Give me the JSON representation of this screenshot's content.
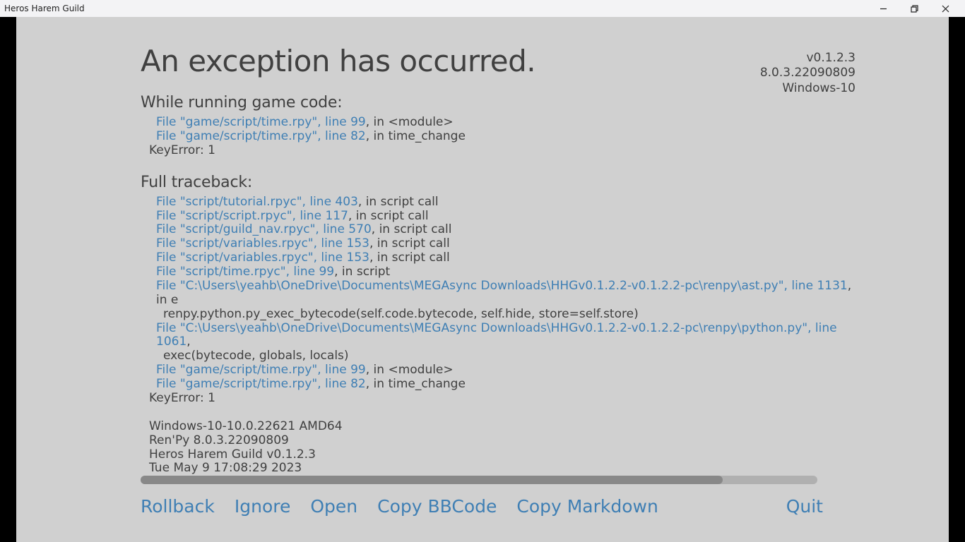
{
  "window": {
    "title": "Heros Harem Guild"
  },
  "versions": {
    "game_version": "v0.1.2.3",
    "renpy_version": "8.0.3.22090809",
    "os": "Windows-10"
  },
  "heading": "An exception has occurred.",
  "section1": {
    "title": "While running game code:",
    "lines": [
      {
        "link": "File \"game/script/time.rpy\", line 99",
        "rest": ", in <module>"
      },
      {
        "link": "File \"game/script/time.rpy\", line 82",
        "rest": ", in time_change"
      }
    ],
    "error": "KeyError: 1"
  },
  "section2": {
    "title": "Full traceback:",
    "lines": [
      {
        "link": "File \"script/tutorial.rpyc\", line 403",
        "rest": ", in script call"
      },
      {
        "link": "File \"script/script.rpyc\", line 117",
        "rest": ", in script call"
      },
      {
        "link": "File \"script/guild_nav.rpyc\", line 570",
        "rest": ", in script call"
      },
      {
        "link": "File \"script/variables.rpyc\", line 153",
        "rest": ", in script call"
      },
      {
        "link": "File \"script/variables.rpyc\", line 153",
        "rest": ", in script call"
      },
      {
        "link": "File \"script/time.rpyc\", line 99",
        "rest": ", in script"
      },
      {
        "link": "File \"C:\\Users\\yeahb\\OneDrive\\Documents\\MEGAsync Downloads\\HHGv0.1.2.2-v0.1.2.2-pc\\renpy\\ast.py\", line 1131",
        "rest": ", in e",
        "sub": "renpy.python.py_exec_bytecode(self.code.bytecode, self.hide, store=self.store)"
      },
      {
        "link": "File \"C:\\Users\\yeahb\\OneDrive\\Documents\\MEGAsync Downloads\\HHGv0.1.2.2-v0.1.2.2-pc\\renpy\\python.py\", line 1061",
        "rest": ",",
        "sub": "exec(bytecode, globals, locals)"
      },
      {
        "link": "File \"game/script/time.rpy\", line 99",
        "rest": ", in <module>"
      },
      {
        "link": "File \"game/script/time.rpy\", line 82",
        "rest": ", in time_change"
      }
    ],
    "error": "KeyError: 1"
  },
  "meta": [
    "Windows-10-10.0.22621 AMD64",
    "Ren'Py 8.0.3.22090809",
    "Heros Harem Guild v0.1.2.3",
    "Tue May  9 17:08:29 2023"
  ],
  "buttons": {
    "rollback": "Rollback",
    "ignore": "Ignore",
    "open": "Open",
    "copy_bbcode": "Copy BBCode",
    "copy_markdown": "Copy Markdown",
    "quit": "Quit"
  }
}
